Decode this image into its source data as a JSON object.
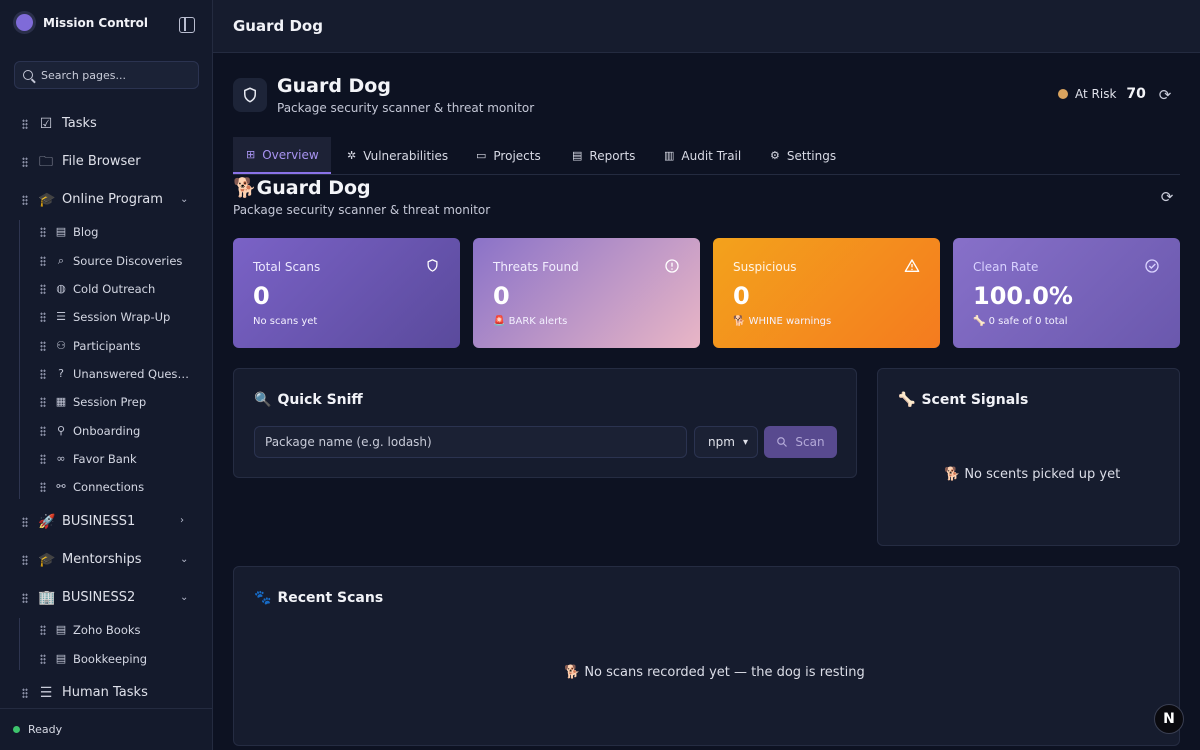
{
  "app": {
    "name": "Mission Control",
    "status": "Ready"
  },
  "sidebar": {
    "search_placeholder": "Search pages...",
    "items": [
      {
        "label": "Tasks",
        "icon": "checkbox-icon"
      },
      {
        "label": "File Browser",
        "icon": "folder-icon"
      },
      {
        "label": "Online Program",
        "icon": "graduation-cap-icon",
        "expanded": true,
        "children": [
          "Blog",
          "Source Discoveries",
          "Cold Outreach",
          "Session Wrap-Up",
          "Participants",
          "Unanswered Questio...",
          "Session Prep",
          "Onboarding",
          "Favor Bank",
          "Connections"
        ]
      },
      {
        "label": "BUSINESS1",
        "icon": "rocket-icon",
        "expanded": false
      },
      {
        "label": "Mentorships",
        "icon": "graduation-cap-icon",
        "expanded": true
      },
      {
        "label": "BUSINESS2",
        "icon": "building-icon",
        "expanded": true,
        "children": [
          "Zoho Books",
          "Bookkeeping"
        ]
      },
      {
        "label": "Human Tasks",
        "icon": "list-check-icon"
      }
    ]
  },
  "topbar": {
    "title": "Guard Dog"
  },
  "header": {
    "title": "Guard Dog",
    "subtitle": "Package security scanner & threat monitor",
    "risk_label": "At Risk",
    "risk_score": "70"
  },
  "tabs": [
    "Overview",
    "Vulnerabilities",
    "Projects",
    "Reports",
    "Audit Trail",
    "Settings"
  ],
  "section": {
    "title": "Guard Dog",
    "emoji": "🐕",
    "subtitle": "Package security scanner & threat monitor"
  },
  "cards": [
    {
      "label": "Total Scans",
      "value": "0",
      "note": "No scans yet",
      "icon": "shield-icon"
    },
    {
      "label": "Threats Found",
      "value": "0",
      "note": "🚨 BARK alerts",
      "icon": "alert-circle-icon"
    },
    {
      "label": "Suspicious",
      "value": "0",
      "note": "🐕 WHINE warnings",
      "icon": "warning-triangle-icon"
    },
    {
      "label": "Clean Rate",
      "value": "100.0%",
      "note": "🦴 0 safe of 0 total",
      "icon": "check-circle-icon"
    }
  ],
  "quick_sniff": {
    "title": "Quick Sniff",
    "emoji": "🔍",
    "input_placeholder": "Package name (e.g. lodash)",
    "ecosystem": "npm",
    "scan_label": "Scan"
  },
  "scent_signals": {
    "title": "Scent Signals",
    "emoji": "🦴",
    "empty": "🐕 No scents picked up yet"
  },
  "recent_scans": {
    "title": "Recent Scans",
    "emoji": "🐾",
    "empty": "🐕 No scans recorded yet — the dog is resting"
  },
  "badge": "N"
}
